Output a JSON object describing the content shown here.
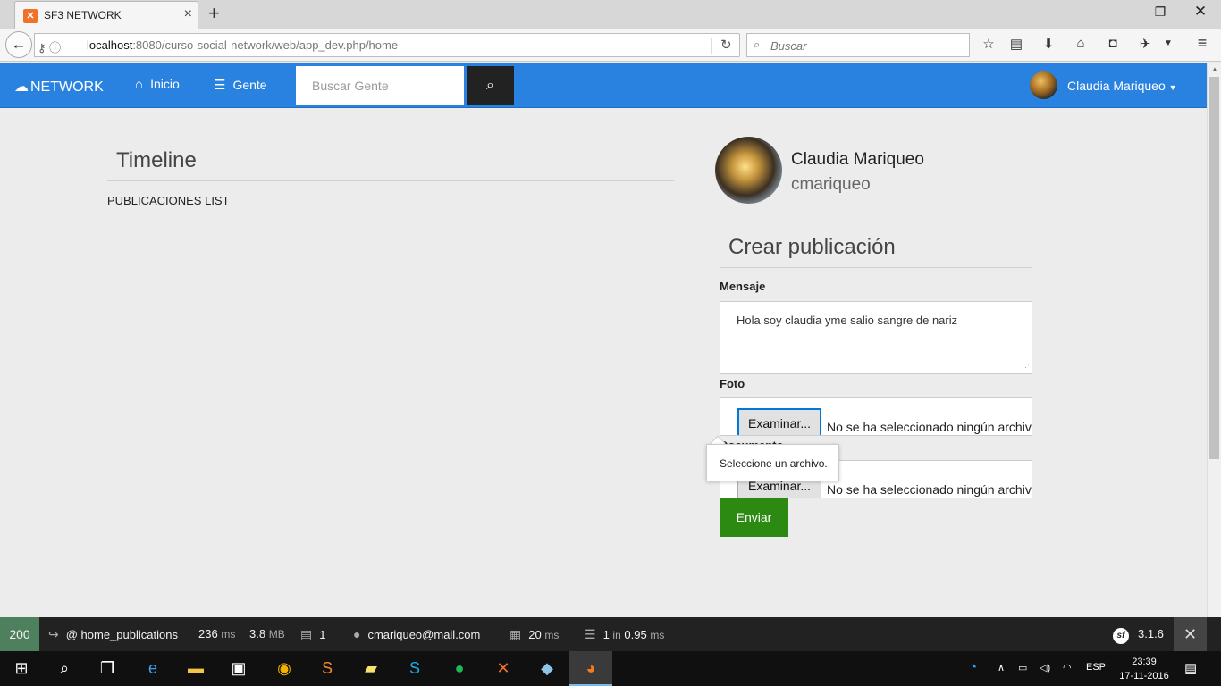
{
  "browser": {
    "tab_title": "SF3 NETWORK",
    "tab_favicon": "xampp-icon",
    "url_host": "localhost",
    "url_rest": ":8080/curso-social-network/web/app_dev.php/home",
    "search_placeholder": "Buscar"
  },
  "navbar": {
    "brand": "NETWORK",
    "links": [
      {
        "label": "Inicio",
        "icon": "home-icon"
      },
      {
        "label": "Gente",
        "icon": "list-icon"
      }
    ],
    "search_placeholder": "Buscar Gente",
    "user_name": "Claudia Mariqueo",
    "accent_color": "#2a82e0"
  },
  "timeline": {
    "title": "Timeline",
    "list_label": "PUBLICACIONES LIST"
  },
  "profile": {
    "name": "Claudia Mariqueo",
    "username": "cmariqueo"
  },
  "form": {
    "title": "Crear publicación",
    "message_label": "Mensaje",
    "message_value": "Hola soy claudia yme salio sangre de nariz",
    "photo_label": "Foto",
    "document_label": "Documento",
    "file_button": "Examinar...",
    "file_status": "No se ha seleccionado ningún archivo.",
    "tooltip": "Seleccione un archivo.",
    "submit_label": "Enviar",
    "submit_color": "#2c8a12"
  },
  "symfony_toolbar": {
    "status": "200",
    "route": "@ home_publications",
    "time_value": "236",
    "time_unit": "ms",
    "memory_value": "3.8",
    "memory_unit": "MB",
    "forms_count": "1",
    "user": "cmariqueo@mail.com",
    "twig_value": "20",
    "twig_unit": "ms",
    "db_value": "1",
    "db_in": "in",
    "db_time": "0.95",
    "db_unit": "ms",
    "version": "3.1.6"
  },
  "taskbar": {
    "language": "ESP",
    "time": "23:39",
    "date": "17-11-2016"
  }
}
